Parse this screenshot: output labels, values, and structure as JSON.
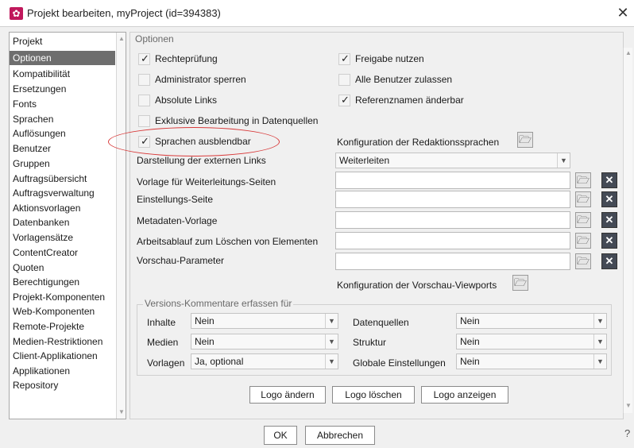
{
  "window": {
    "title": "Projekt bearbeiten, myProject (id=394383)",
    "close": "✕",
    "help": "?"
  },
  "nav": {
    "items": [
      {
        "label": "Projekt"
      },
      {
        "label": "Optionen",
        "selected": true
      },
      {
        "label": "Kompatibilität"
      },
      {
        "label": "Ersetzungen"
      },
      {
        "label": "Fonts"
      },
      {
        "label": "Sprachen"
      },
      {
        "label": "Auflösungen"
      },
      {
        "label": "Benutzer"
      },
      {
        "label": "Gruppen"
      },
      {
        "label": "Auftragsübersicht"
      },
      {
        "label": "Auftragsverwaltung"
      },
      {
        "label": "Aktionsvorlagen"
      },
      {
        "label": "Datenbanken"
      },
      {
        "label": "Vorlagensätze"
      },
      {
        "label": "ContentCreator"
      },
      {
        "label": "Quoten"
      },
      {
        "label": "Berechtigungen"
      },
      {
        "label": "Projekt-Komponenten"
      },
      {
        "label": "Web-Komponenten"
      },
      {
        "label": "Remote-Projekte"
      },
      {
        "label": "Medien-Restriktionen"
      },
      {
        "label": "Client-Applikationen"
      },
      {
        "label": "Applikationen"
      },
      {
        "label": "Repository"
      }
    ]
  },
  "options": {
    "legend": "Optionen",
    "checkboxes": {
      "rechtepruefung": {
        "label": "Rechteprüfung",
        "checked": true
      },
      "freigabe": {
        "label": "Freigabe nutzen",
        "checked": true
      },
      "admin_sperren": {
        "label": "Administrator sperren",
        "checked": false
      },
      "alle_benutzer": {
        "label": "Alle Benutzer zulassen",
        "checked": false
      },
      "absolute_links": {
        "label": "Absolute Links",
        "checked": false
      },
      "referenznamen": {
        "label": "Referenznamen änderbar",
        "checked": true
      },
      "exklusive": {
        "label": "Exklusive Bearbeitung in Datenquellen",
        "checked": false
      },
      "sprachen": {
        "label": "Sprachen ausblendbar",
        "checked": true
      }
    },
    "konfig_redaktion": "Konfiguration der Redaktionssprachen",
    "darstellung_label": "Darstellung der externen Links",
    "darstellung_value": "Weiterleiten",
    "vorlage_weiterleitung": "Vorlage für Weiterleitungs-Seiten",
    "einstellungs_seite": "Einstellungs-Seite",
    "metadaten_vorlage": "Metadaten-Vorlage",
    "arbeitsablauf": "Arbeitsablauf zum Löschen von Elementen",
    "vorschau_parameter": "Vorschau-Parameter",
    "konfig_viewports": "Konfiguration der Vorschau-Viewports"
  },
  "versions": {
    "legend": "Versions-Kommentare erfassen für",
    "inhalte": {
      "label": "Inhalte",
      "value": "Nein"
    },
    "medien": {
      "label": "Medien",
      "value": "Nein"
    },
    "vorlagen": {
      "label": "Vorlagen",
      "value": "Ja, optional"
    },
    "datenquellen": {
      "label": "Datenquellen",
      "value": "Nein"
    },
    "struktur": {
      "label": "Struktur",
      "value": "Nein"
    },
    "globale": {
      "label": "Globale Einstellungen",
      "value": "Nein"
    }
  },
  "logo_buttons": {
    "aendern": "Logo ändern",
    "loeschen": "Logo löschen",
    "anzeigen": "Logo anzeigen"
  },
  "footer": {
    "ok": "OK",
    "abbrechen": "Abbrechen"
  },
  "icons": {
    "folder": "🗁",
    "remove": "✕"
  },
  "colors": {
    "selection": "#6e6e6e",
    "highlight": "#d83a3a",
    "app_icon": "#c0185c"
  }
}
